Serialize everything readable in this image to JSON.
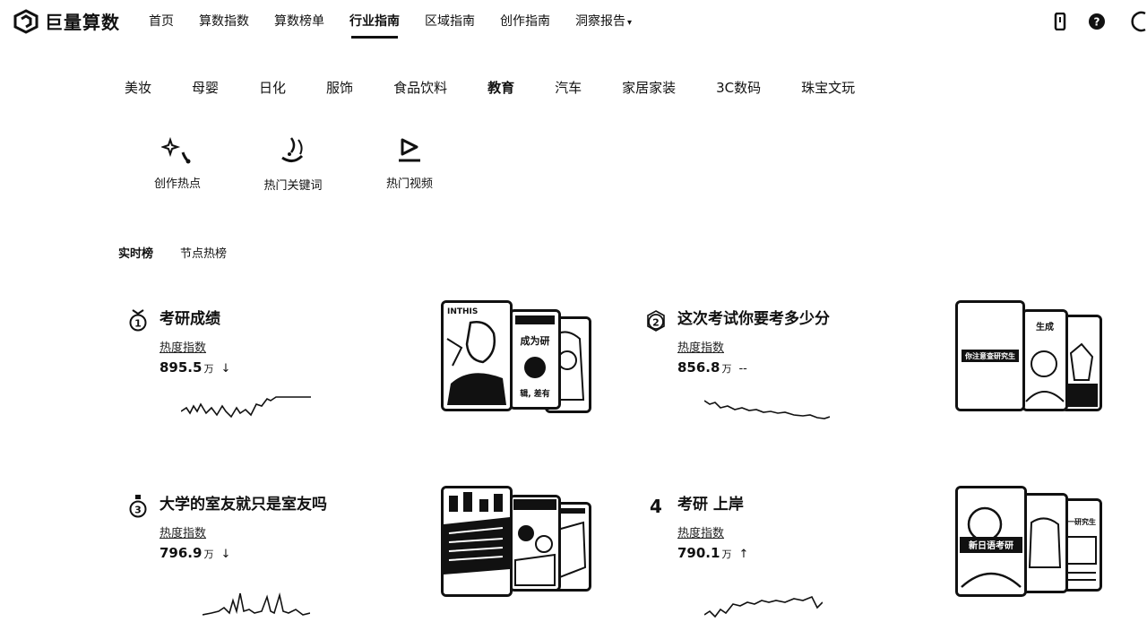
{
  "brand": {
    "name": "巨量算数"
  },
  "nav": {
    "items": [
      {
        "label": "首页",
        "active": false
      },
      {
        "label": "算数指数",
        "active": false
      },
      {
        "label": "算数榜单",
        "active": false
      },
      {
        "label": "行业指南",
        "active": true
      },
      {
        "label": "区域指南",
        "active": false
      },
      {
        "label": "创作指南",
        "active": false
      },
      {
        "label": "洞察报告",
        "active": false
      }
    ],
    "report_caret": "▾"
  },
  "header_icons": [
    "phone-icon",
    "help-icon",
    "avatar-icon"
  ],
  "categories": [
    {
      "label": "美妆"
    },
    {
      "label": "母婴"
    },
    {
      "label": "日化"
    },
    {
      "label": "服饰"
    },
    {
      "label": "食品饮料"
    },
    {
      "label": "教育",
      "active": true
    },
    {
      "label": "汽车"
    },
    {
      "label": "家居家装"
    },
    {
      "label": "3C数码"
    },
    {
      "label": "珠宝文玩"
    }
  ],
  "features": [
    {
      "label": "创作热点",
      "icon": "sparkle-icon"
    },
    {
      "label": "热门关键词",
      "icon": "keyword-icon"
    },
    {
      "label": "热门视频",
      "icon": "video-play-icon"
    }
  ],
  "subtabs": [
    {
      "label": "实时榜",
      "active": true
    },
    {
      "label": "节点热榜",
      "active": false
    }
  ],
  "cards": [
    {
      "rank": "1",
      "title": "考研成绩",
      "index_label": "热度指数",
      "value": "895.5",
      "unit": "万",
      "trend": "↓",
      "thumb_texts": [
        "INTHIS",
        "成为研",
        "辑, 差有"
      ]
    },
    {
      "rank": "2",
      "title": "这次考试你要考多少分",
      "index_label": "热度指数",
      "value": "856.8",
      "unit": "万",
      "trend": "--",
      "thumb_texts": [
        "你注意查研究生",
        "生成"
      ]
    },
    {
      "rank": "3",
      "title": "大学的室友就只是室友吗",
      "index_label": "热度指数",
      "value": "796.9",
      "unit": "万",
      "trend": "↓",
      "thumb_texts": []
    },
    {
      "rank": "4",
      "title": "考研 上岸",
      "index_label": "热度指数",
      "value": "790.1",
      "unit": "万",
      "trend": "↑",
      "thumb_texts": [
        "一研究生",
        "新日语考研"
      ]
    }
  ],
  "colors": {
    "text": "#111111",
    "background": "#ffffff",
    "accent": "#111111"
  }
}
